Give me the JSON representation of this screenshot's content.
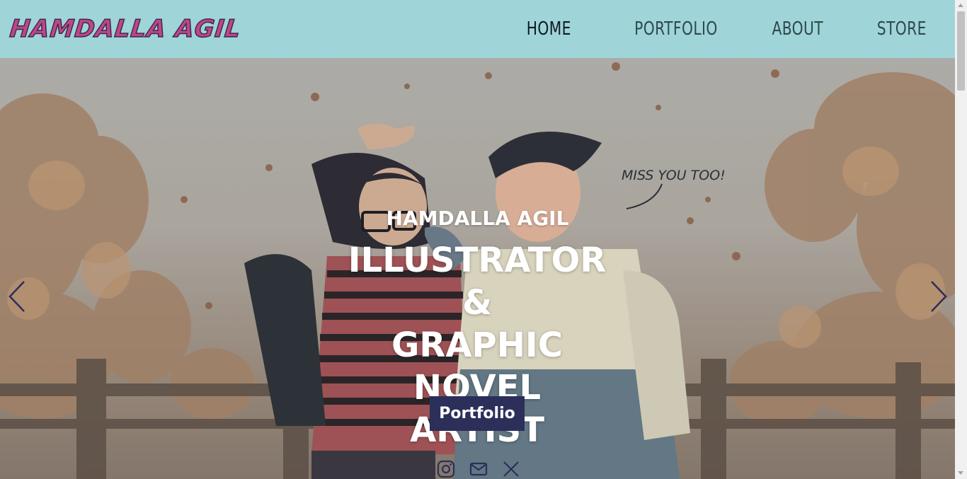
{
  "header": {
    "logo": "HAMDALLA AGIL",
    "nav": [
      {
        "label": "HOME",
        "active": true
      },
      {
        "label": "PORTFOLIO",
        "active": false
      },
      {
        "label": "ABOUT",
        "active": false
      },
      {
        "label": "STORE",
        "active": false
      }
    ]
  },
  "hero": {
    "name": "HAMDALLA AGIL",
    "title_lines": [
      "ILLUSTRATOR &",
      "GRAPHIC NOVEL",
      "ARTIST"
    ],
    "button_label": "Portfolio",
    "speech_bubble": "MISS YOU TOO!",
    "socials": [
      "instagram-icon",
      "mail-icon",
      "x-icon"
    ]
  },
  "colors": {
    "header_bg": "#9fd4d8",
    "logo": "#c0458a",
    "button_bg": "#2b2f5a",
    "arrow": "#2b2f5a"
  }
}
